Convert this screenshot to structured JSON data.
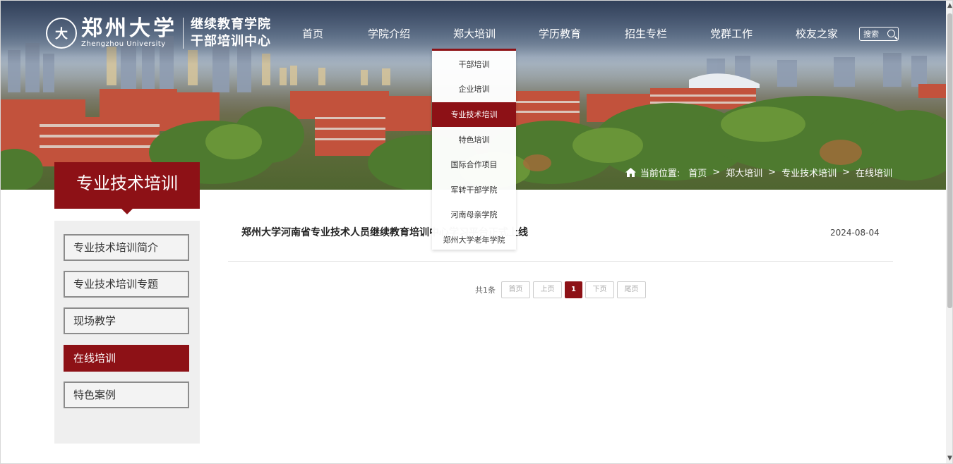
{
  "header": {
    "logo_emblem": "大",
    "university_cn": "郑州大学",
    "university_en": "Zhengzhou University",
    "college_line1": "继续教育学院",
    "college_line2": "干部培训中心",
    "search_label": "搜索"
  },
  "nav": {
    "items": [
      {
        "label": "首页"
      },
      {
        "label": "学院介绍"
      },
      {
        "label": "郑大培训"
      },
      {
        "label": "学历教育"
      },
      {
        "label": "招生专栏"
      },
      {
        "label": "党群工作"
      },
      {
        "label": "校友之家"
      }
    ]
  },
  "dropdown": {
    "items": [
      {
        "label": "干部培训"
      },
      {
        "label": "企业培训"
      },
      {
        "label": "专业技术培训",
        "active": true
      },
      {
        "label": "特色培训"
      },
      {
        "label": "国际合作项目"
      },
      {
        "label": "军转干部学院"
      },
      {
        "label": "河南母亲学院"
      },
      {
        "label": "郑州大学老年学院"
      }
    ]
  },
  "breadcrumb": {
    "prefix": "当前位置:",
    "items": [
      "首页",
      "郑大培训",
      "专业技术培训",
      "在线培训"
    ],
    "separator": ">"
  },
  "sidebar": {
    "title": "专业技术培训",
    "items": [
      {
        "label": "专业技术培训简介"
      },
      {
        "label": "专业技术培训专题"
      },
      {
        "label": "现场教学"
      },
      {
        "label": "在线培训",
        "active": true
      },
      {
        "label": "特色案例"
      }
    ]
  },
  "main": {
    "articles": [
      {
        "title": "郑州大学河南省专业技术人员继续教育培训中心学习平台正式上线",
        "date": "2024-08-04"
      }
    ],
    "pager": {
      "total": "共1条",
      "first": "首页",
      "prev": "上页",
      "current": "1",
      "next": "下页",
      "last": "尾页"
    }
  },
  "colors": {
    "accent": "#8d1116",
    "side_bg": "#efefef"
  }
}
